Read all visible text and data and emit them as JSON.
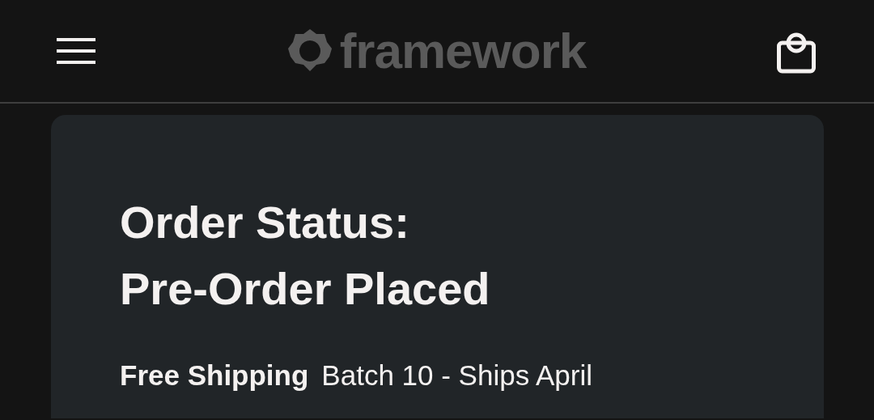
{
  "header": {
    "logo_text": "framework"
  },
  "order": {
    "title": "Order Status:",
    "status": "Pre-Order Placed",
    "shipping_label": "Free Shipping",
    "shipping_detail": "Batch 10 - Ships April"
  }
}
